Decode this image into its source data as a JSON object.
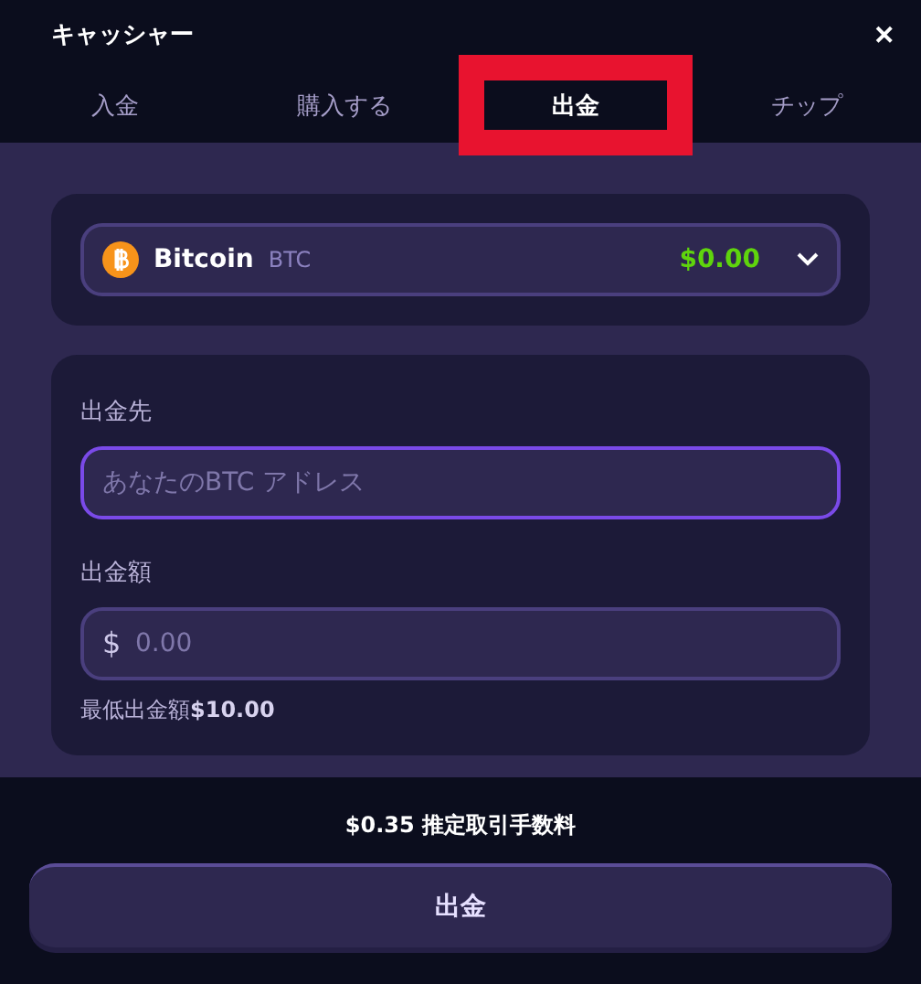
{
  "window": {
    "title": "キャッシャー",
    "close": "✕"
  },
  "tabs": [
    {
      "label": "入金",
      "selected": false,
      "highlighted": false
    },
    {
      "label": "購入する",
      "selected": false,
      "highlighted": false
    },
    {
      "label": "出金",
      "selected": true,
      "highlighted": true
    },
    {
      "label": "チップ",
      "selected": false,
      "highlighted": false
    }
  ],
  "currency": {
    "name": "Bitcoin",
    "code": "BTC",
    "balance": "$0.00"
  },
  "address": {
    "label": "出金先",
    "placeholder": "あなたのBTC アドレス",
    "focused": true
  },
  "amount": {
    "label": "出金額",
    "prefix": "$",
    "placeholder": "0.00",
    "minimum": "最低出金額**$10.00**"
  },
  "fee": "$0.35 推定取引手数料",
  "submit": "出金"
}
